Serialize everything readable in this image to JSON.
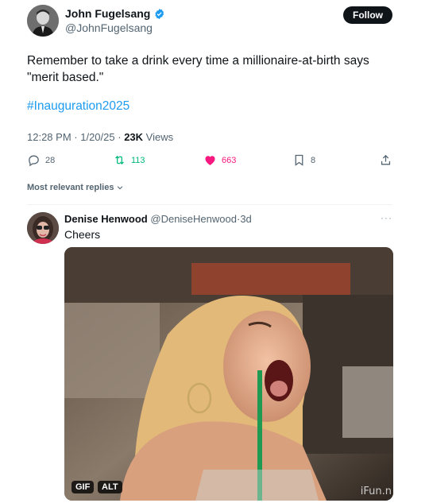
{
  "tweet": {
    "author_name": "John Fugelsang",
    "author_handle": "@JohnFugelsang",
    "follow_label": "Follow",
    "text": "Remember to take a drink every time a millionaire-at-birth says \"merit based.\"",
    "hashtag": "#Inauguration2025",
    "time": "12:28 PM",
    "date": "1/20/25",
    "views_count": "23K",
    "views_label": "Views",
    "replies": "28",
    "reposts": "113",
    "likes": "663",
    "bookmarks": "8"
  },
  "replies_sort_label": "Most relevant replies",
  "reply": {
    "author_name": "Denise Henwood",
    "author_handle": "@DeniseHenwood",
    "age": "3d",
    "text": "Cheers",
    "media": {
      "gif_badge": "GIF",
      "alt_badge": "ALT",
      "watermark": "iFun.n"
    }
  },
  "icons": {
    "verified": "verified-badge-icon",
    "reply": "reply-icon",
    "retweet": "retweet-icon",
    "like": "heart-icon",
    "bookmark": "bookmark-icon",
    "share": "share-icon",
    "more": "more-icon",
    "chevron": "chevron-down-icon"
  },
  "colors": {
    "accent": "#1d9bf0",
    "retweet": "#00ba7c",
    "like": "#f91880",
    "secondary_text": "#536471"
  }
}
